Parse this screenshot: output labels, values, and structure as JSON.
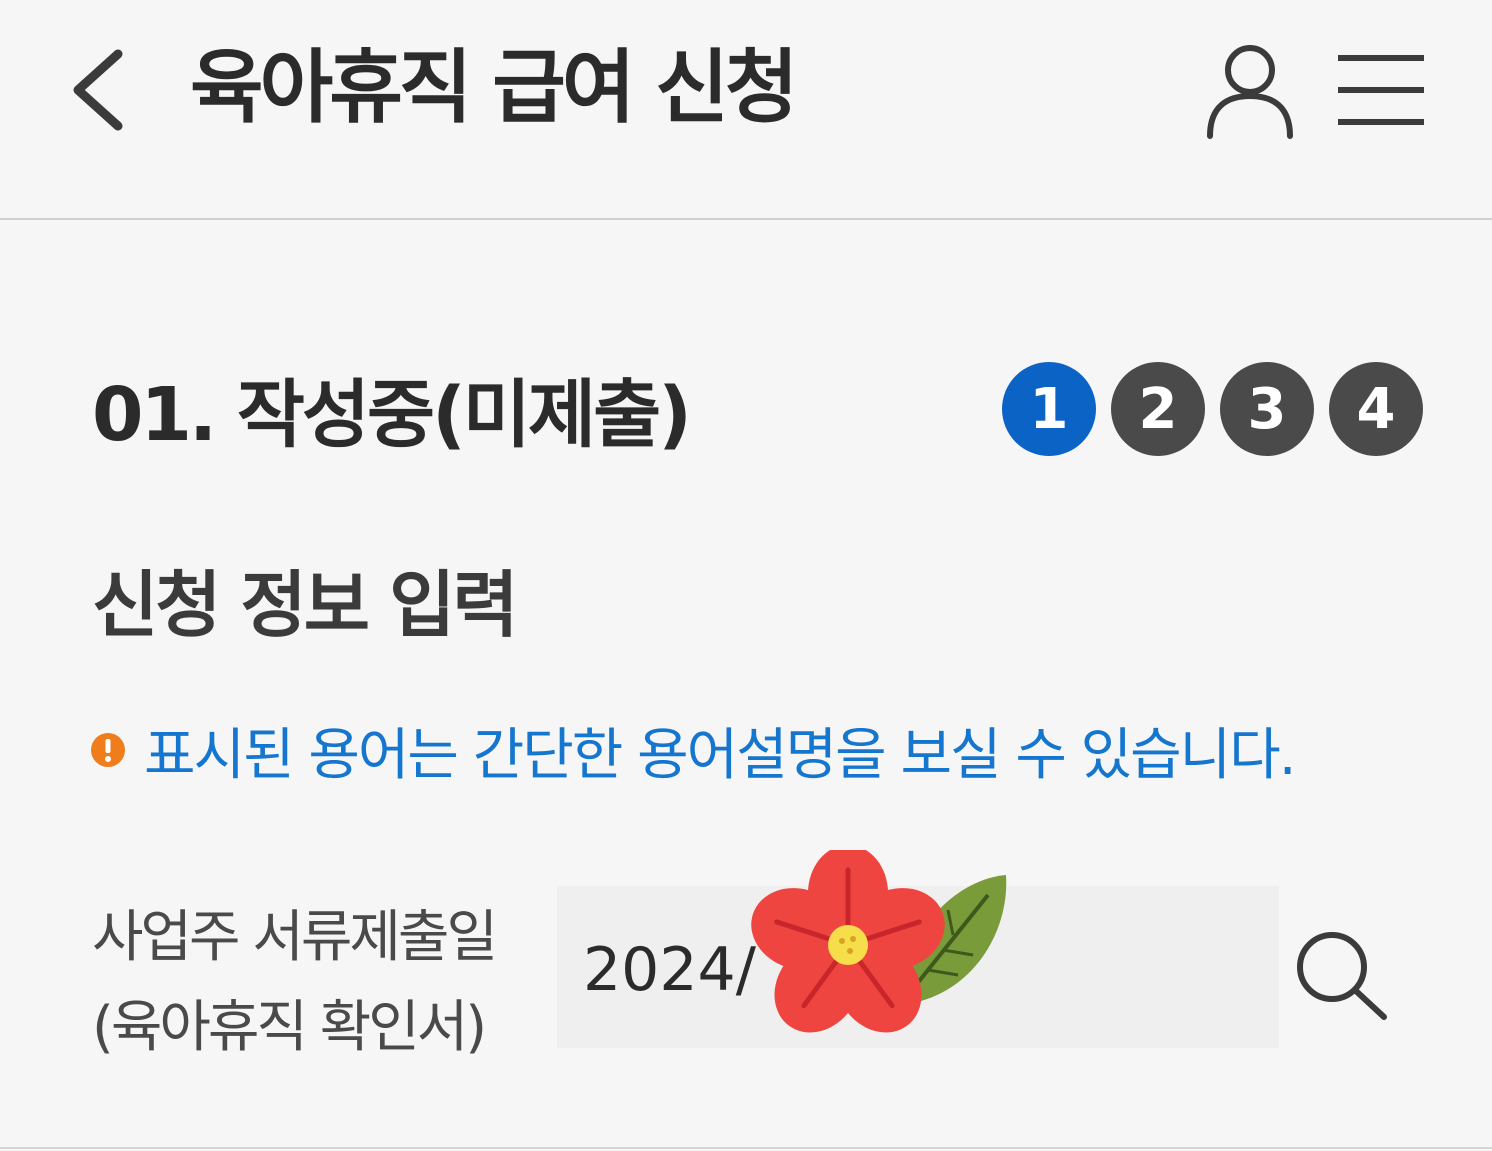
{
  "header": {
    "title": "육아휴직 급여 신청",
    "back_icon": "chevron-left-icon",
    "user_icon": "user-icon",
    "menu_icon": "hamburger-menu-icon"
  },
  "status": {
    "title": "01. 작성중(미제출)",
    "steps": [
      "1",
      "2",
      "3",
      "4"
    ],
    "active_step": 1,
    "active_color": "#0b63c6",
    "inactive_color": "#4a4a4a"
  },
  "section": {
    "title": "신청 정보 입력"
  },
  "notice": {
    "icon": "warning-icon",
    "icon_color": "#f07d1c",
    "text": "표시된 용어는 간단한 용어설명을 보실 수 있습니다.",
    "text_color": "#1576cf"
  },
  "form": {
    "employer_submit_date": {
      "label_line1": "사업주 서류제출일",
      "label_line2": "(육아휴직 확인서)",
      "value": "2024/",
      "search_icon": "search-icon"
    }
  },
  "overlay": {
    "sticker": "flower-sticker"
  }
}
